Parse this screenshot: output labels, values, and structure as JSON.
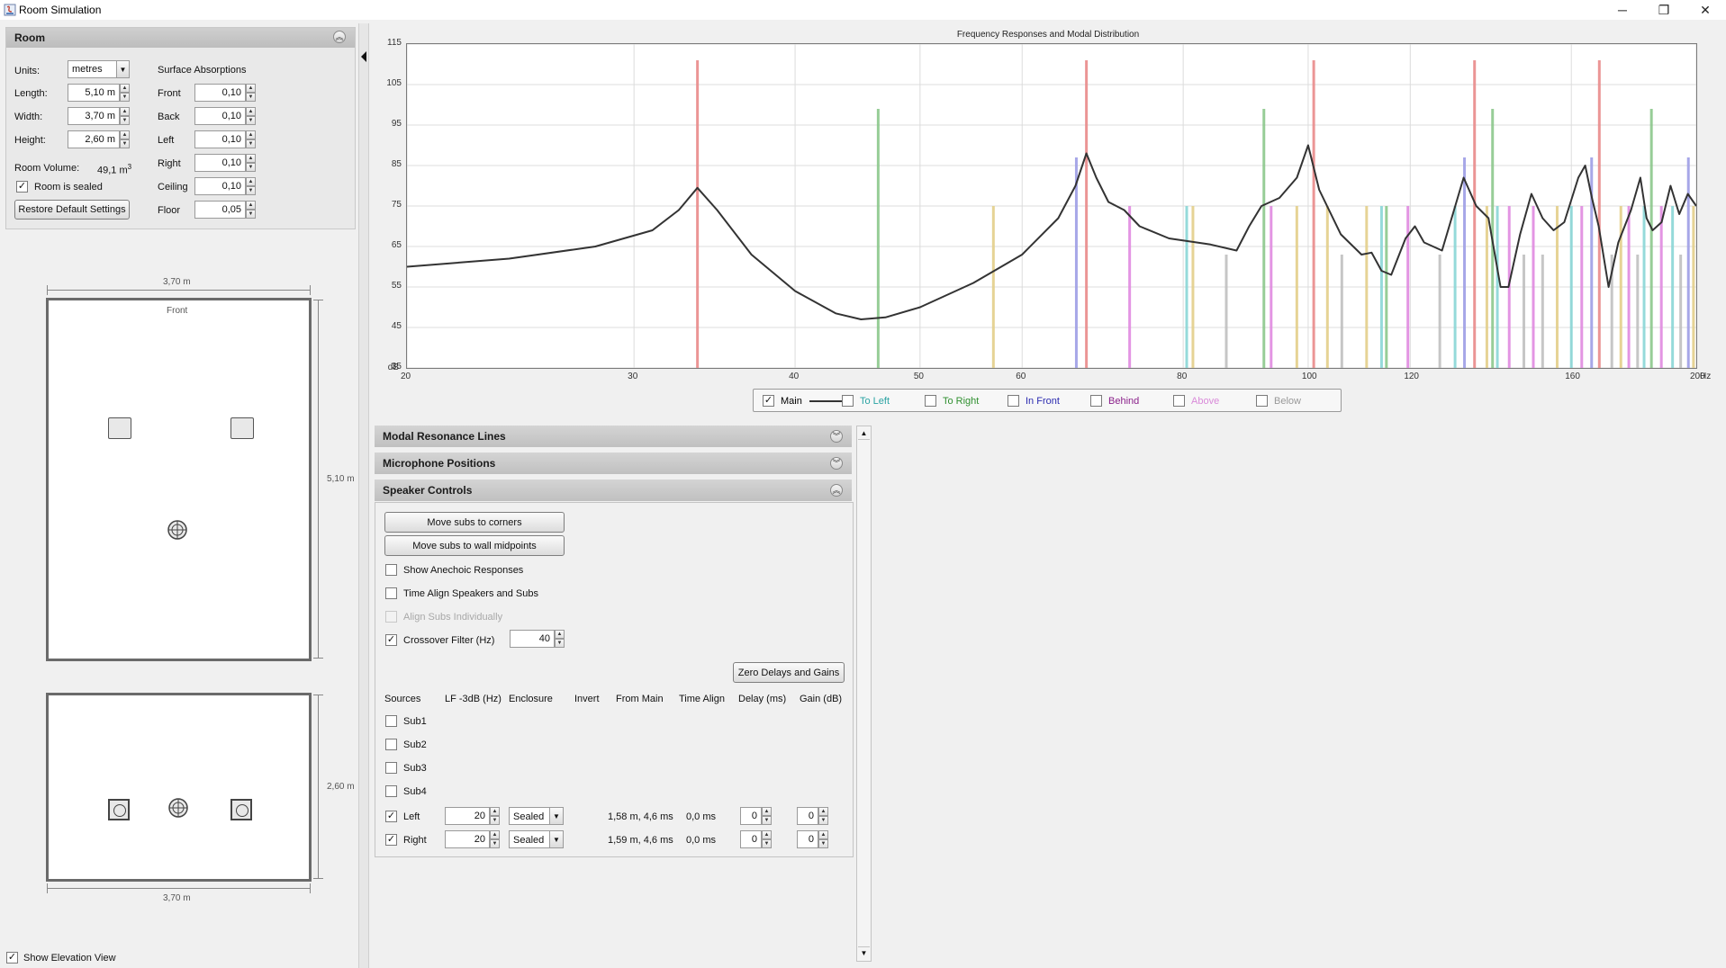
{
  "window": {
    "title": "Room Simulation",
    "minimize": "─",
    "maximize": "❐",
    "close": "✕"
  },
  "room": {
    "section_title": "Room",
    "units_label": "Units:",
    "units_value": "metres",
    "length_label": "Length:",
    "length_value": "5,10 m",
    "width_label": "Width:",
    "width_value": "3,70 m",
    "height_label": "Height:",
    "height_value": "2,60 m",
    "volume_label": "Room Volume:",
    "volume_value": "49,1 m",
    "volume_unit_sup": "3",
    "sealed_label": "Room is sealed",
    "sealed_checked": true,
    "restore_button": "Restore Default Settings",
    "absorption_title": "Surface Absorptions",
    "absorptions": [
      {
        "label": "Front",
        "value": "0,10"
      },
      {
        "label": "Back",
        "value": "0,10"
      },
      {
        "label": "Left",
        "value": "0,10"
      },
      {
        "label": "Right",
        "value": "0,10"
      },
      {
        "label": "Ceiling",
        "value": "0,10"
      },
      {
        "label": "Floor",
        "value": "0,05"
      }
    ]
  },
  "plan": {
    "top_width": "3,70 m",
    "front_label": "Front",
    "length": "5,10 m",
    "elevation_height": "2,60 m",
    "bottom_width": "3,70 m",
    "show_elevation_label": "Show Elevation View",
    "show_elevation_checked": true
  },
  "chart_data": {
    "type": "line",
    "title": "Frequency Responses and Modal Distribution",
    "ylabel": "dB",
    "xunit": "Hz",
    "x_scale": "log",
    "xlim": [
      20,
      200
    ],
    "ylim": [
      35,
      115
    ],
    "y_ticks": [
      35,
      45,
      55,
      65,
      75,
      85,
      95,
      105,
      115
    ],
    "x_ticks": [
      20,
      30,
      40,
      50,
      60,
      80,
      100,
      120,
      160,
      200
    ],
    "grid": true,
    "series": [
      {
        "name": "Main",
        "color": "#333333",
        "points": [
          [
            20,
            60
          ],
          [
            24,
            62
          ],
          [
            28,
            65
          ],
          [
            31,
            69
          ],
          [
            32.5,
            74
          ],
          [
            33.6,
            79.5
          ],
          [
            34.8,
            74
          ],
          [
            37,
            63
          ],
          [
            40,
            54
          ],
          [
            43,
            48.5
          ],
          [
            45,
            47
          ],
          [
            47,
            47.5
          ],
          [
            50,
            50
          ],
          [
            55,
            56
          ],
          [
            60,
            63
          ],
          [
            64,
            72
          ],
          [
            66,
            80
          ],
          [
            67.3,
            88
          ],
          [
            68.5,
            82
          ],
          [
            70,
            76
          ],
          [
            72,
            74
          ],
          [
            74,
            70
          ],
          [
            78,
            67
          ],
          [
            84,
            65.5
          ],
          [
            88,
            64
          ],
          [
            90,
            70
          ],
          [
            92,
            75
          ],
          [
            95,
            77
          ],
          [
            98,
            82
          ],
          [
            100,
            90
          ],
          [
            102,
            79
          ],
          [
            106,
            68
          ],
          [
            110,
            63
          ],
          [
            112,
            63.5
          ],
          [
            114,
            59
          ],
          [
            116,
            58
          ],
          [
            119,
            67
          ],
          [
            121,
            70
          ],
          [
            123,
            66
          ],
          [
            127,
            64
          ],
          [
            132,
            82
          ],
          [
            135,
            75
          ],
          [
            138,
            72
          ],
          [
            141,
            55
          ],
          [
            143,
            55
          ],
          [
            146,
            68
          ],
          [
            149,
            78
          ],
          [
            152,
            72
          ],
          [
            155,
            69
          ],
          [
            158,
            71
          ],
          [
            162,
            82
          ],
          [
            164,
            85
          ],
          [
            166,
            77
          ],
          [
            168,
            70
          ],
          [
            171,
            55
          ],
          [
            174,
            66
          ],
          [
            178,
            74
          ],
          [
            181,
            82
          ],
          [
            183,
            72
          ],
          [
            185,
            69
          ],
          [
            188,
            71
          ],
          [
            191,
            80
          ],
          [
            194,
            73
          ],
          [
            197,
            78
          ],
          [
            200,
            75
          ]
        ]
      }
    ],
    "modal_lines": [
      {
        "f": 33.6,
        "db": 111,
        "color": "#e98a8a"
      },
      {
        "f": 46.4,
        "db": 99,
        "color": "#8cc88c"
      },
      {
        "f": 57,
        "db": 75,
        "color": "#e4cf8a"
      },
      {
        "f": 66.1,
        "db": 87,
        "color": "#9e9ee6"
      },
      {
        "f": 67.3,
        "db": 111,
        "color": "#e98a8a"
      },
      {
        "f": 72.7,
        "db": 75,
        "color": "#e08ae0"
      },
      {
        "f": 80.5,
        "db": 75,
        "color": "#8ad6d6"
      },
      {
        "f": 81.4,
        "db": 75,
        "color": "#e4cf8a"
      },
      {
        "f": 86.4,
        "db": 63,
        "color": "#c0c0c0"
      },
      {
        "f": 92.4,
        "db": 99,
        "color": "#8cc88c"
      },
      {
        "f": 93.6,
        "db": 75,
        "color": "#e08ae0"
      },
      {
        "f": 98,
        "db": 75,
        "color": "#e4cf8a"
      },
      {
        "f": 101,
        "db": 111,
        "color": "#e98a8a"
      },
      {
        "f": 103.5,
        "db": 75,
        "color": "#e4cf8a"
      },
      {
        "f": 106.2,
        "db": 63,
        "color": "#c0c0c0"
      },
      {
        "f": 111,
        "db": 75,
        "color": "#e4cf8a"
      },
      {
        "f": 114,
        "db": 75,
        "color": "#8ad6d6"
      },
      {
        "f": 115,
        "db": 75,
        "color": "#8cc88c"
      },
      {
        "f": 119.5,
        "db": 75,
        "color": "#e08ae0"
      },
      {
        "f": 126.5,
        "db": 63,
        "color": "#c0c0c0"
      },
      {
        "f": 130,
        "db": 75,
        "color": "#8ad6d6"
      },
      {
        "f": 132.2,
        "db": 87,
        "color": "#9e9ee6"
      },
      {
        "f": 134.6,
        "db": 111,
        "color": "#e98a8a"
      },
      {
        "f": 137.6,
        "db": 75,
        "color": "#e4cf8a"
      },
      {
        "f": 139,
        "db": 99,
        "color": "#8cc88c"
      },
      {
        "f": 140.2,
        "db": 75,
        "color": "#8ad6d6"
      },
      {
        "f": 143.2,
        "db": 75,
        "color": "#e08ae0"
      },
      {
        "f": 147,
        "db": 63,
        "color": "#c0c0c0"
      },
      {
        "f": 149.5,
        "db": 75,
        "color": "#e08ae0"
      },
      {
        "f": 152,
        "db": 63,
        "color": "#c0c0c0"
      },
      {
        "f": 156,
        "db": 75,
        "color": "#e4cf8a"
      },
      {
        "f": 160,
        "db": 75,
        "color": "#8ad6d6"
      },
      {
        "f": 163,
        "db": 75,
        "color": "#e08ae0"
      },
      {
        "f": 165.9,
        "db": 87,
        "color": "#9e9ee6"
      },
      {
        "f": 168.2,
        "db": 111,
        "color": "#e98a8a"
      },
      {
        "f": 172,
        "db": 63,
        "color": "#c0c0c0"
      },
      {
        "f": 174.8,
        "db": 75,
        "color": "#e4cf8a"
      },
      {
        "f": 177.3,
        "db": 75,
        "color": "#e08ae0"
      },
      {
        "f": 180.1,
        "db": 63,
        "color": "#c0c0c0"
      },
      {
        "f": 182.2,
        "db": 75,
        "color": "#8ad6d6"
      },
      {
        "f": 184.6,
        "db": 99,
        "color": "#8cc88c"
      },
      {
        "f": 187.9,
        "db": 75,
        "color": "#e08ae0"
      },
      {
        "f": 191.7,
        "db": 75,
        "color": "#8ad6d6"
      },
      {
        "f": 194.5,
        "db": 63,
        "color": "#c0c0c0"
      },
      {
        "f": 197.2,
        "db": 87,
        "color": "#9e9ee6"
      },
      {
        "f": 199,
        "db": 75,
        "color": "#e4cf8a"
      }
    ]
  },
  "legend": [
    {
      "label": "Main",
      "checked": true,
      "color": "#000000",
      "line": true
    },
    {
      "label": "To Left",
      "checked": false,
      "color": "#2aa3a3"
    },
    {
      "label": "To Right",
      "checked": false,
      "color": "#2f8f2f"
    },
    {
      "label": "In Front",
      "checked": false,
      "color": "#2b2bb0"
    },
    {
      "label": "Behind",
      "checked": false,
      "color": "#8a1f8a"
    },
    {
      "label": "Above",
      "checked": false,
      "color": "#d98ad9"
    },
    {
      "label": "Below",
      "checked": false,
      "color": "#999999"
    }
  ],
  "panels": {
    "modal": "Modal Resonance Lines",
    "mic": "Microphone Positions",
    "speaker": "Speaker Controls"
  },
  "speaker": {
    "corners_button": "Move subs to corners",
    "midpoints_button": "Move subs to wall midpoints",
    "anechoic_label": "Show Anechoic Responses",
    "time_align_label": "Time Align Speakers and Subs",
    "align_subs_label": "Align Subs Individually",
    "crossover_label": "Crossover Filter (Hz)",
    "crossover_value": "40",
    "zero_button": "Zero Delays and Gains",
    "columns": [
      "Sources",
      "LF -3dB (Hz)",
      "Enclosure",
      "Invert",
      "From Main",
      "Time Align",
      "Delay (ms)",
      "Gain (dB)"
    ],
    "subs": [
      "Sub1",
      "Sub2",
      "Sub3",
      "Sub4"
    ],
    "rows": [
      {
        "name": "Left",
        "lf": "20",
        "enclosure": "Sealed",
        "from_main": "1,58 m, 4,6 ms",
        "time_align": "0,0 ms",
        "delay": "0",
        "gain": "0"
      },
      {
        "name": "Right",
        "lf": "20",
        "enclosure": "Sealed",
        "from_main": "1,59 m, 4,6 ms",
        "time_align": "0,0 ms",
        "delay": "0",
        "gain": "0"
      }
    ]
  }
}
